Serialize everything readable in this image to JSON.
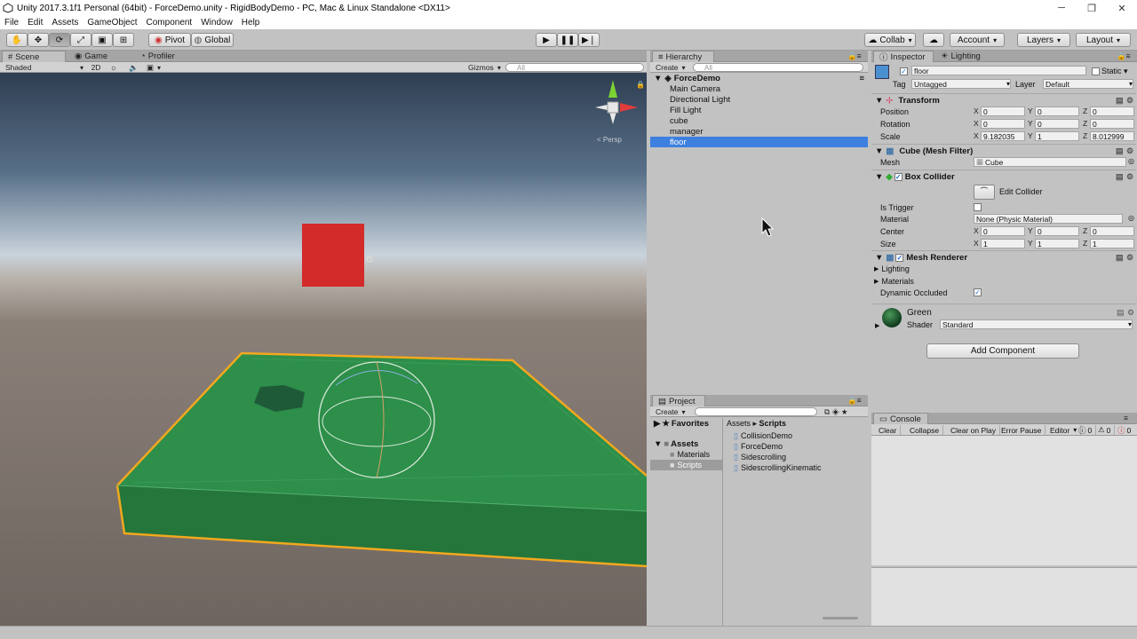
{
  "window": {
    "title": "Unity 2017.3.1f1 Personal (64bit) - ForceDemo.unity - RigidBodyDemo - PC, Mac & Linux Standalone <DX11>",
    "icon": "unity-icon",
    "controls": [
      "minimize-icon",
      "restore-icon",
      "close-icon"
    ]
  },
  "menu": [
    "File",
    "Edit",
    "Assets",
    "GameObject",
    "Component",
    "Window",
    "Help"
  ],
  "toolbar": {
    "tools": [
      "hand-icon",
      "move-icon",
      "rotate-icon",
      "scale-icon",
      "rect-icon",
      "transform-icon"
    ],
    "pivot": "Pivot",
    "global": "Global",
    "collab": "Collab",
    "account": "Account",
    "layers": "Layers",
    "layout": "Layout"
  },
  "scene": {
    "tabs": [
      "Scene",
      "Game",
      "Profiler"
    ],
    "shading": "Shaded",
    "mode2d": "2D",
    "gizmos": "Gizmos",
    "search_placeholder": "All",
    "persp": "< Persp",
    "colors": {
      "sky": "#b8c8d8",
      "ground": "#7a6f66",
      "floor": "#2a8a45",
      "cube": "#d32a2a",
      "outline": "#f2a81e"
    }
  },
  "hierarchy": {
    "tab": "Hierarchy",
    "create": "Create",
    "search_placeholder": "All",
    "scene_name": "ForceDemo",
    "items": [
      "Main Camera",
      "Directional Light",
      "Fill Light",
      "cube",
      "manager",
      "floor"
    ],
    "selected": "floor"
  },
  "project": {
    "tab": "Project",
    "create": "Create",
    "favorites": "Favorites",
    "assets": "Assets",
    "folders": [
      "Materials",
      "Scripts"
    ],
    "breadcrumb": [
      "Assets",
      "Scripts"
    ],
    "scripts": [
      "CollisionDemo",
      "ForceDemo",
      "Sidescrolling",
      "SidescrollingKinematic"
    ]
  },
  "inspector": {
    "tabs": [
      "Inspector",
      "Lighting"
    ],
    "object_name": "floor",
    "static": "Static",
    "tag_label": "Tag",
    "tag_value": "Untagged",
    "layer_label": "Layer",
    "layer_value": "Default",
    "transform": {
      "title": "Transform",
      "position_label": "Position",
      "rotation_label": "Rotation",
      "scale_label": "Scale",
      "position": [
        "0",
        "0",
        "0"
      ],
      "rotation": [
        "0",
        "0",
        "0"
      ],
      "scale": [
        "9.182035",
        "1",
        "8.012999"
      ]
    },
    "mesh_filter": {
      "title": "Cube (Mesh Filter)",
      "mesh_label": "Mesh",
      "mesh_value": "Cube"
    },
    "box_collider": {
      "title": "Box Collider",
      "edit_collider": "Edit Collider",
      "is_trigger_label": "Is Trigger",
      "material_label": "Material",
      "material_value": "None (Physic Material)",
      "center_label": "Center",
      "size_label": "Size",
      "center": [
        "0",
        "0",
        "0"
      ],
      "size": [
        "1",
        "1",
        "1"
      ]
    },
    "mesh_renderer": {
      "title": "Mesh Renderer",
      "lighting": "Lighting",
      "materials": "Materials",
      "dynamic_occluded": "Dynamic Occluded"
    },
    "material": {
      "name": "Green",
      "shader_label": "Shader",
      "shader_value": "Standard"
    },
    "add_component": "Add Component",
    "axes": [
      "X",
      "Y",
      "Z"
    ]
  },
  "console": {
    "tab": "Console",
    "buttons": [
      "Clear",
      "Collapse",
      "Clear on Play",
      "Error Pause",
      "Editor"
    ],
    "counts": [
      "0",
      "0",
      "0"
    ]
  }
}
